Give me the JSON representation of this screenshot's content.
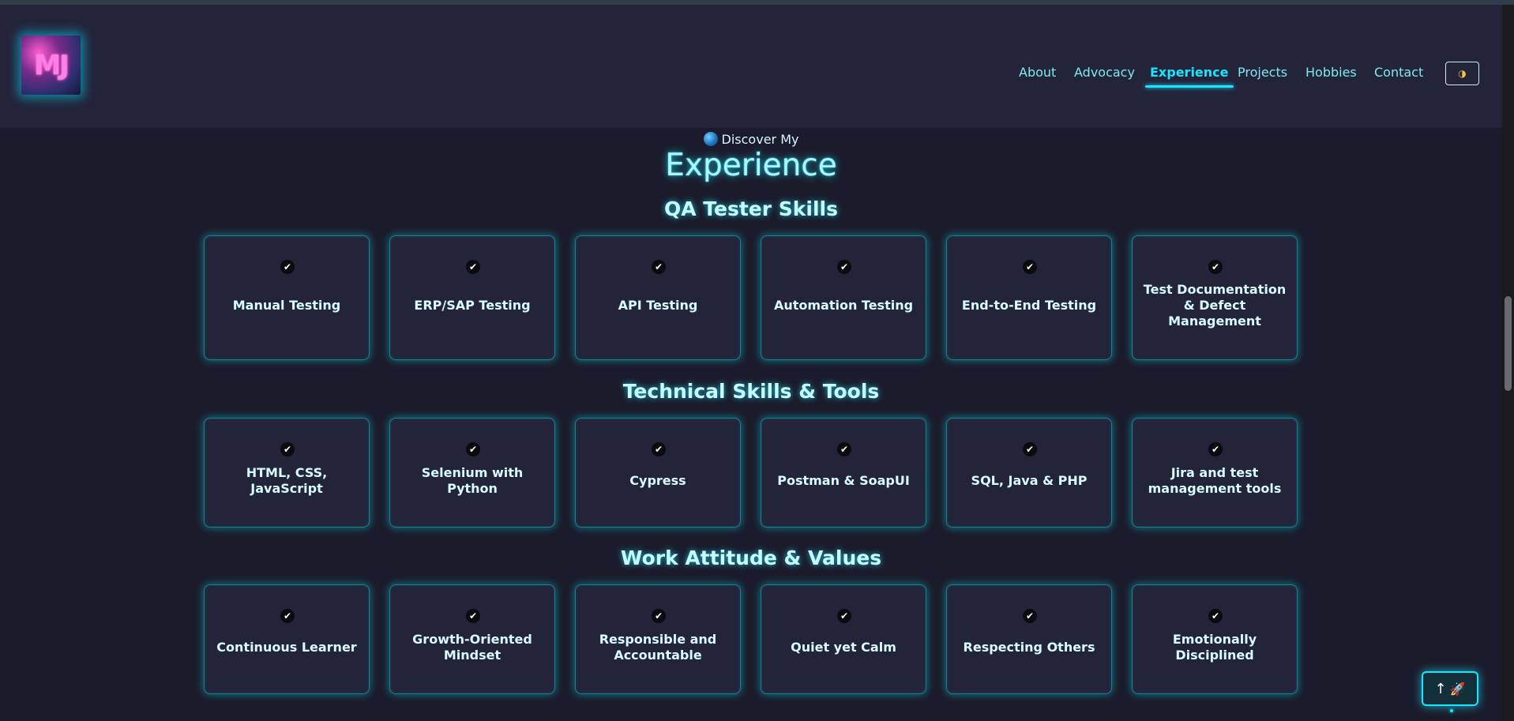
{
  "header": {
    "logo_text": "MJ",
    "nav": [
      {
        "label": "About",
        "active": false
      },
      {
        "label": "Advocacy",
        "active": false
      },
      {
        "label": "Experience",
        "active": true
      },
      {
        "label": "Projects",
        "active": false
      },
      {
        "label": "Hobbies",
        "active": false
      },
      {
        "label": "Contact",
        "active": false
      }
    ],
    "theme_toggle": {
      "icon": "half-moon-icon",
      "glyph": "◑"
    }
  },
  "section": {
    "eyebrow": "Discover My",
    "eyebrow_icon": "globe-icon",
    "title": "Experience"
  },
  "groups": [
    {
      "title": "QA Tester Skills",
      "items": [
        "Manual Testing",
        "ERP/SAP Testing",
        "API Testing",
        "Automation Testing",
        "End-to-End Testing",
        "Test Documentation & Defect Management"
      ]
    },
    {
      "title": "Technical Skills & Tools",
      "items": [
        "HTML, CSS, JavaScript",
        "Selenium with Python",
        "Cypress",
        "Postman & SoapUI",
        "SQL, Java & PHP",
        "Jira and test management tools"
      ]
    },
    {
      "title": "Work Attitude & Values",
      "items": [
        "Continuous Learner",
        "Growth-Oriented Mindset",
        "Responsible and Accountable",
        "Quiet yet Calm",
        "Respecting Others",
        "Emotionally Disciplined"
      ]
    }
  ],
  "check_glyph": "✔",
  "back_to_top": {
    "arrow": "↑",
    "icon": "rocket-icon",
    "glyph": "🚀"
  },
  "colors": {
    "accent": "#19e6ff",
    "background": "#1b1b2b",
    "card": "#23233a"
  }
}
